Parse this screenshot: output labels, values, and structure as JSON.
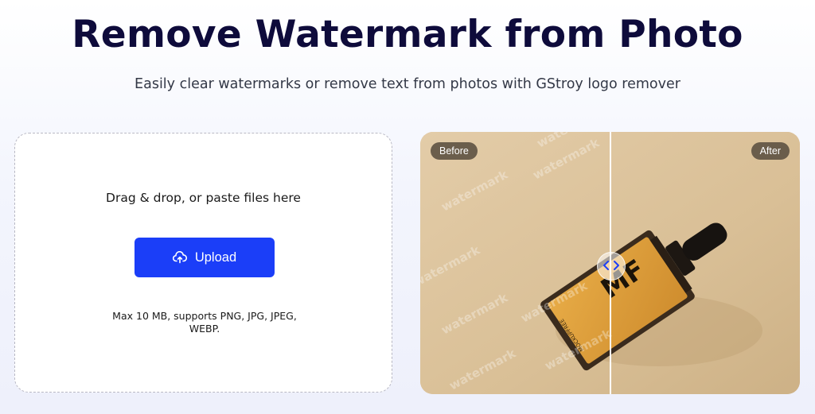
{
  "header": {
    "title": "Remove Watermark from Photo",
    "subtitle": "Easily clear watermarks or remove text from photos with GStroy logo remover"
  },
  "uploader": {
    "drop_text": "Drag & drop, or paste files here",
    "upload_label": "Upload",
    "upload_icon": "cloud-upload-icon",
    "limits_text": "Max 10 MB, supports PNG, JPG, JPEG, WEBP."
  },
  "comparison": {
    "before_label": "Before",
    "after_label": "After",
    "watermark_text": "watermark",
    "product_label": {
      "logo": "MF",
      "brand": "MOCKUPFREE"
    },
    "handle_icon": "chevrons-left-right-icon"
  },
  "colors": {
    "title": "#0e0b3b",
    "accent": "#1b3ef8",
    "image_background": "#dcc39d",
    "bottle_label": "#e0a13f"
  }
}
